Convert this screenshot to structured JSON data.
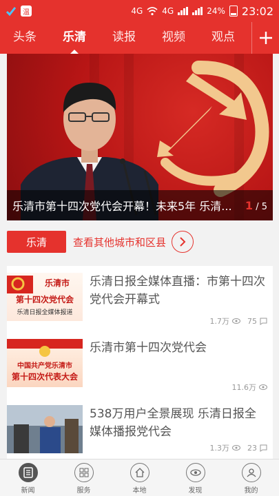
{
  "status": {
    "battery": "24%",
    "time": "23:02",
    "net1": "4G",
    "net2": "4G"
  },
  "tabs": [
    {
      "label": "头条"
    },
    {
      "label": "乐清"
    },
    {
      "label": "读报"
    },
    {
      "label": "视频"
    },
    {
      "label": "观点"
    }
  ],
  "hero": {
    "title": "乐清市第十四次党代会开幕！未来5年 乐清...",
    "page_current": "1",
    "page_total": "/ 5"
  },
  "city": {
    "tag": "乐清",
    "link": "查看其他城市和区县"
  },
  "news": [
    {
      "title": "乐清日报全媒体直播：市第十四次党代会开幕式",
      "views": "1.7万",
      "comments": "75",
      "thumb": [
        "乐清市",
        "第十四次党代会",
        "乐清日报全媒体报道"
      ]
    },
    {
      "title": "乐清市第十四次党代会",
      "views": "11.6万",
      "comments": "",
      "thumb": [
        "中国共产党乐清市",
        "第十四次代表大会"
      ]
    },
    {
      "title": "538万用户全景展现 乐清日报全媒体播报党代会",
      "views": "1.3万",
      "comments": "23",
      "thumb": []
    }
  ],
  "bottom_nav": [
    {
      "label": "新闻",
      "icon": "news-icon"
    },
    {
      "label": "服务",
      "icon": "grid-icon"
    },
    {
      "label": "本地",
      "icon": "home-icon"
    },
    {
      "label": "发现",
      "icon": "eye-icon"
    },
    {
      "label": "我的",
      "icon": "user-icon"
    }
  ],
  "colors": {
    "brand": "#e5322d"
  }
}
